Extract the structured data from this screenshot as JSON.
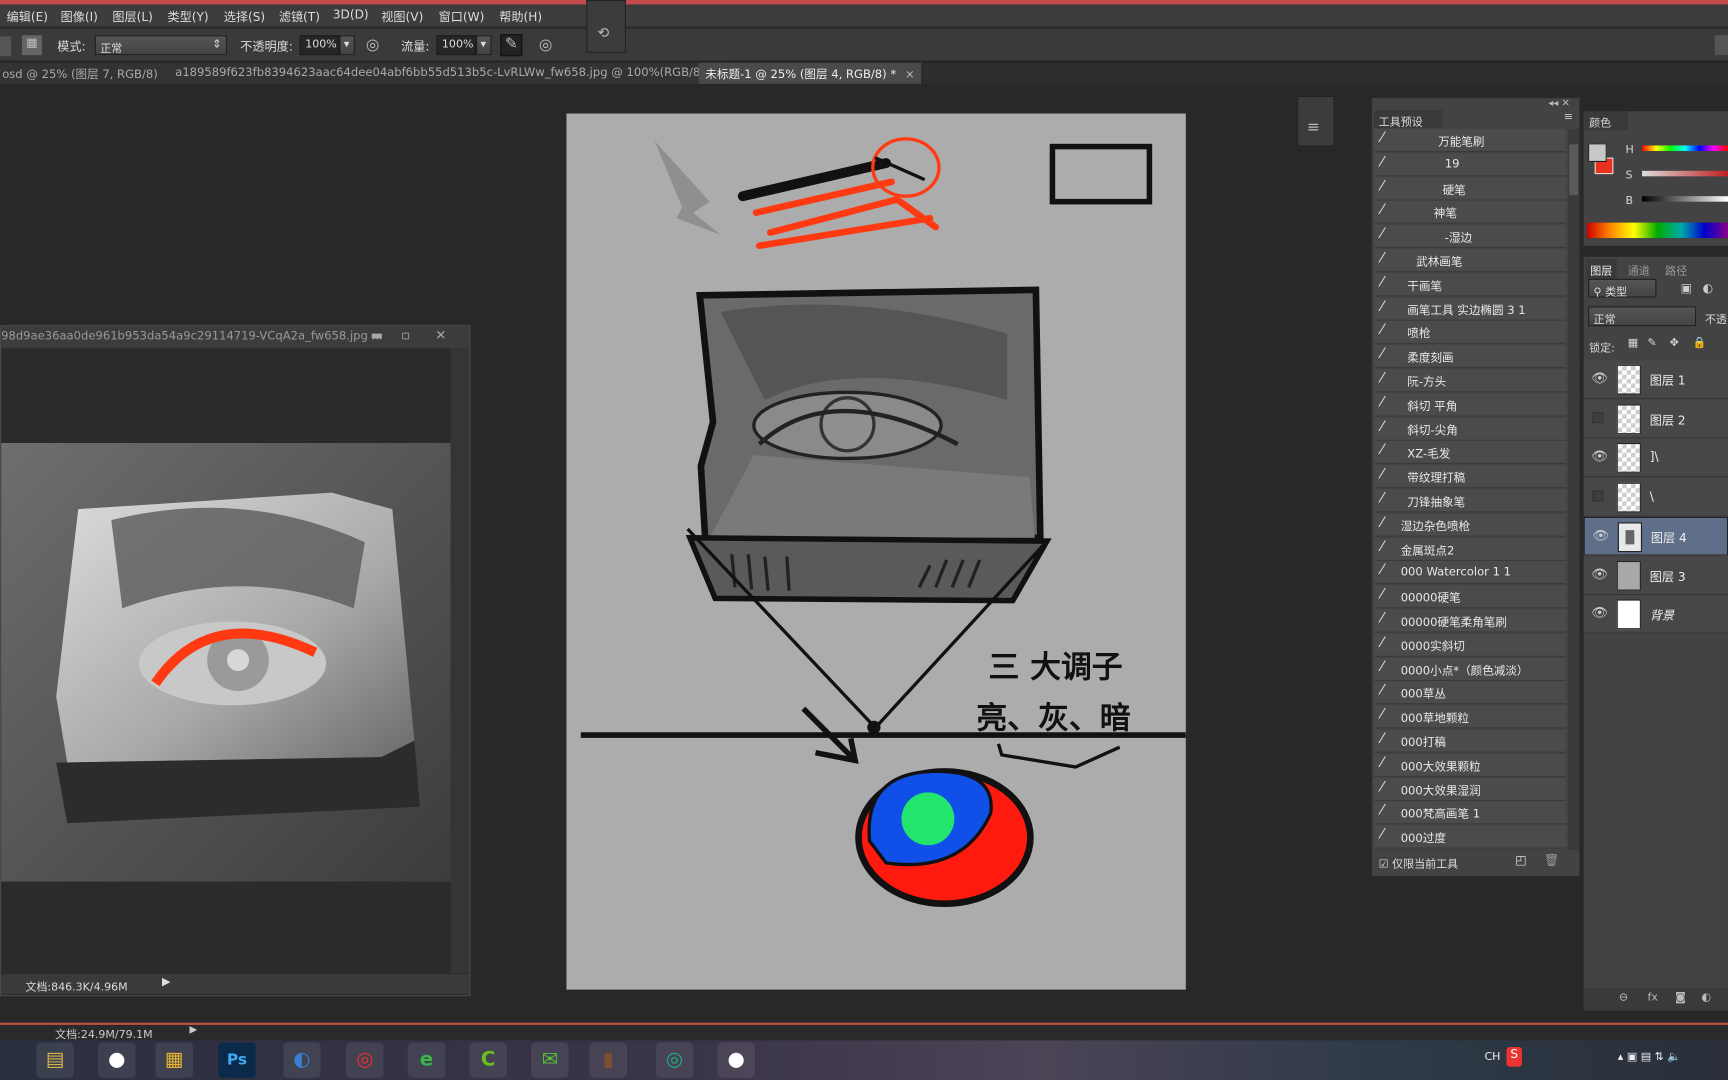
{
  "menubar": {
    "items": [
      "编辑(E)",
      "图像(I)",
      "图层(L)",
      "类型(Y)",
      "选择(S)",
      "滤镜(T)",
      "3D(D)",
      "视图(V)",
      "窗口(W)",
      "帮助(H)"
    ]
  },
  "options": {
    "mode_label": "模式:",
    "mode_value": "正常",
    "opacity_label": "不透明度:",
    "opacity_value": "100%",
    "flow_label": "流量:",
    "flow_value": "100%"
  },
  "tabs": [
    {
      "label": "osd @ 25% (图层 7, RGB/8)",
      "close": "×"
    },
    {
      "label": "a189589f623fb8394623aac64dee04abf6bb55d513b5c-LvRLWw_fw658.jpg @ 100%(RGB/8)",
      "close": "×"
    },
    {
      "label": "未标题-1 @ 25% (图层 4, RGB/8) *",
      "close": "×",
      "active": true
    }
  ],
  "ref_window": {
    "title": "98d9ae36aa0de961b953da54a9c29114719-VCqA2a_fw658.jpg ...",
    "status": "文档:846.3K/4.96M"
  },
  "canvas_text": {
    "line1": "三 大调子",
    "line2": "亮、灰、暗"
  },
  "presets": {
    "title": "工具预设",
    "items": [
      "万能笔刷",
      "19",
      "硬笔",
      "神笔",
      "-湿边",
      "武林画笔",
      "干画笔",
      "画笔工具 实边椭圆 3 1",
      "喷枪",
      "柔度刻画",
      "阮-方头",
      "斜切 平角",
      "斜切-尖角",
      "XZ-毛发",
      "带纹理打稿",
      "刀锋抽象笔",
      "湿边杂色喷枪",
      "金属斑点2",
      "000 Watercolor 1 1",
      "00000硬笔",
      "00000硬笔柔角笔刷",
      "0000实斜切",
      "0000小点*（颜色减淡）",
      "000草丛",
      "000草地颗粒",
      "000打稿",
      "000大效果颗粒",
      "000大效果湿润",
      "000梵高画笔 1",
      "000过度"
    ],
    "current_tool_only": "仅限当前工具"
  },
  "color_panel": {
    "title": "颜色",
    "h": "H",
    "s": "S",
    "b": "B",
    "foreground": "#c8c8c8",
    "background": "#e8321e"
  },
  "layers_panel": {
    "tabs": [
      "图层",
      "通道",
      "路径"
    ],
    "filter": "类型",
    "blend": "正常",
    "opacity_label": "不透",
    "lock_label": "锁定:",
    "layers": [
      {
        "name": "图层 1",
        "visible": true
      },
      {
        "name": "图层 2",
        "visible": false
      },
      {
        "name": "]\\",
        "visible": true
      },
      {
        "name": "\\",
        "visible": false
      },
      {
        "name": "图层 4",
        "visible": true,
        "selected": true
      },
      {
        "name": "图层 3",
        "visible": true
      },
      {
        "name": "背景",
        "visible": true
      }
    ]
  },
  "status": {
    "doc": "文档:24.9M/79.1M"
  },
  "taskbar": {
    "apps": [
      "file-explorer",
      "qq",
      "notepad",
      "photoshop",
      "browser",
      "netease-music",
      "browser-360",
      "camtasia",
      "wechat",
      "image-viewer",
      "iqiyi",
      "qq-2"
    ],
    "lang": "CH"
  }
}
